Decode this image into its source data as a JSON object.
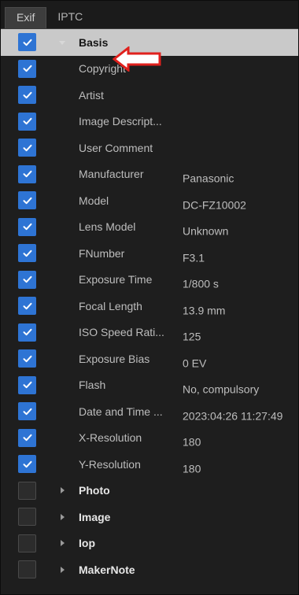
{
  "tabs": [
    {
      "label": "Exif",
      "active": true
    },
    {
      "label": "IPTC",
      "active": false
    }
  ],
  "rows": [
    {
      "label": "Basis",
      "value": "",
      "checked": true,
      "group": true,
      "expanded": true,
      "selected": true
    },
    {
      "label": "Copyright",
      "value": "",
      "checked": true
    },
    {
      "label": "Artist",
      "value": "",
      "checked": true
    },
    {
      "label": "Image Descript...",
      "value": "",
      "checked": true
    },
    {
      "label": "User Comment",
      "value": "",
      "checked": true
    },
    {
      "label": "Manufacturer",
      "value": "Panasonic",
      "checked": true
    },
    {
      "label": "Model",
      "value": "DC-FZ10002",
      "checked": true
    },
    {
      "label": "Lens Model",
      "value": "Unknown",
      "checked": true
    },
    {
      "label": "FNumber",
      "value": "F3.1",
      "checked": true
    },
    {
      "label": "Exposure Time",
      "value": "1/800 s",
      "checked": true
    },
    {
      "label": "Focal Length",
      "value": "13.9 mm",
      "checked": true
    },
    {
      "label": "ISO Speed Rati...",
      "value": "125",
      "checked": true
    },
    {
      "label": "Exposure Bias",
      "value": "0 EV",
      "checked": true
    },
    {
      "label": "Flash",
      "value": "No, compulsory",
      "checked": true
    },
    {
      "label": "Date and Time ...",
      "value": "2023:04:26 11:27:49",
      "checked": true
    },
    {
      "label": "X-Resolution",
      "value": "180",
      "checked": true
    },
    {
      "label": "Y-Resolution",
      "value": "180",
      "checked": true
    },
    {
      "label": "Photo",
      "value": "",
      "checked": false,
      "group": true,
      "expanded": false
    },
    {
      "label": "Image",
      "value": "",
      "checked": false,
      "group": true,
      "expanded": false
    },
    {
      "label": "Iop",
      "value": "",
      "checked": false,
      "group": true,
      "expanded": false
    },
    {
      "label": "MakerNote",
      "value": "",
      "checked": false,
      "group": true,
      "expanded": false
    }
  ],
  "colors": {
    "accent": "#2e74d4",
    "selected_row": "#c9c9c9",
    "callout": "#e0201c"
  },
  "icons": {
    "check": "checkmark-icon",
    "expanded": "triangle-down-icon",
    "collapsed": "triangle-right-icon",
    "callout": "red-arrow-icon"
  }
}
